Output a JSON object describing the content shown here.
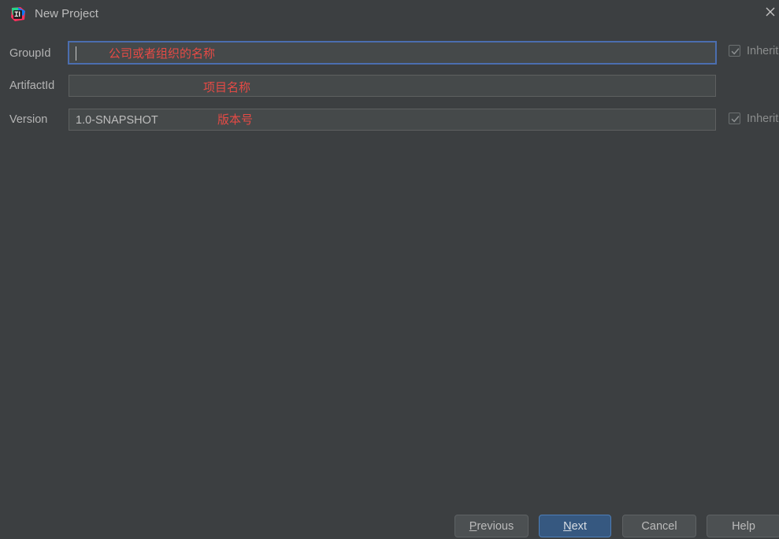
{
  "window": {
    "title": "New Project",
    "app_icon": "intellij-idea-icon",
    "close_icon": "close-icon",
    "background_color": "#3c3f41"
  },
  "form": {
    "rows": [
      {
        "label": "GroupId",
        "value": "",
        "annotation": "公司或者组织的名称",
        "focused": true,
        "has_caret": true,
        "checkbox": {
          "label": "Inherit",
          "checked": true,
          "enabled": false
        }
      },
      {
        "label": "ArtifactId",
        "value": "",
        "annotation": "项目名称",
        "focused": false,
        "has_caret": false,
        "checkbox": null
      },
      {
        "label": "Version",
        "value": "1.0-SNAPSHOT",
        "annotation": "版本号",
        "focused": false,
        "has_caret": false,
        "checkbox": {
          "label": "Inherit",
          "checked": true,
          "enabled": false
        }
      }
    ]
  },
  "buttons": {
    "previous": {
      "label": "Previous",
      "mnemonic": "P",
      "primary": false
    },
    "next": {
      "label": "Next",
      "mnemonic": "N",
      "primary": true
    },
    "cancel": {
      "label": "Cancel",
      "mnemonic": "",
      "primary": false
    },
    "help": {
      "label": "Help",
      "mnemonic": "",
      "primary": false
    }
  },
  "colors": {
    "dialog_background": "#3c3f41",
    "field_background": "#45494a",
    "focus_border": "#4b6eaf",
    "primary_button": "#365880",
    "annotation_red": "#e64a45",
    "text": "#bbbbbb"
  }
}
